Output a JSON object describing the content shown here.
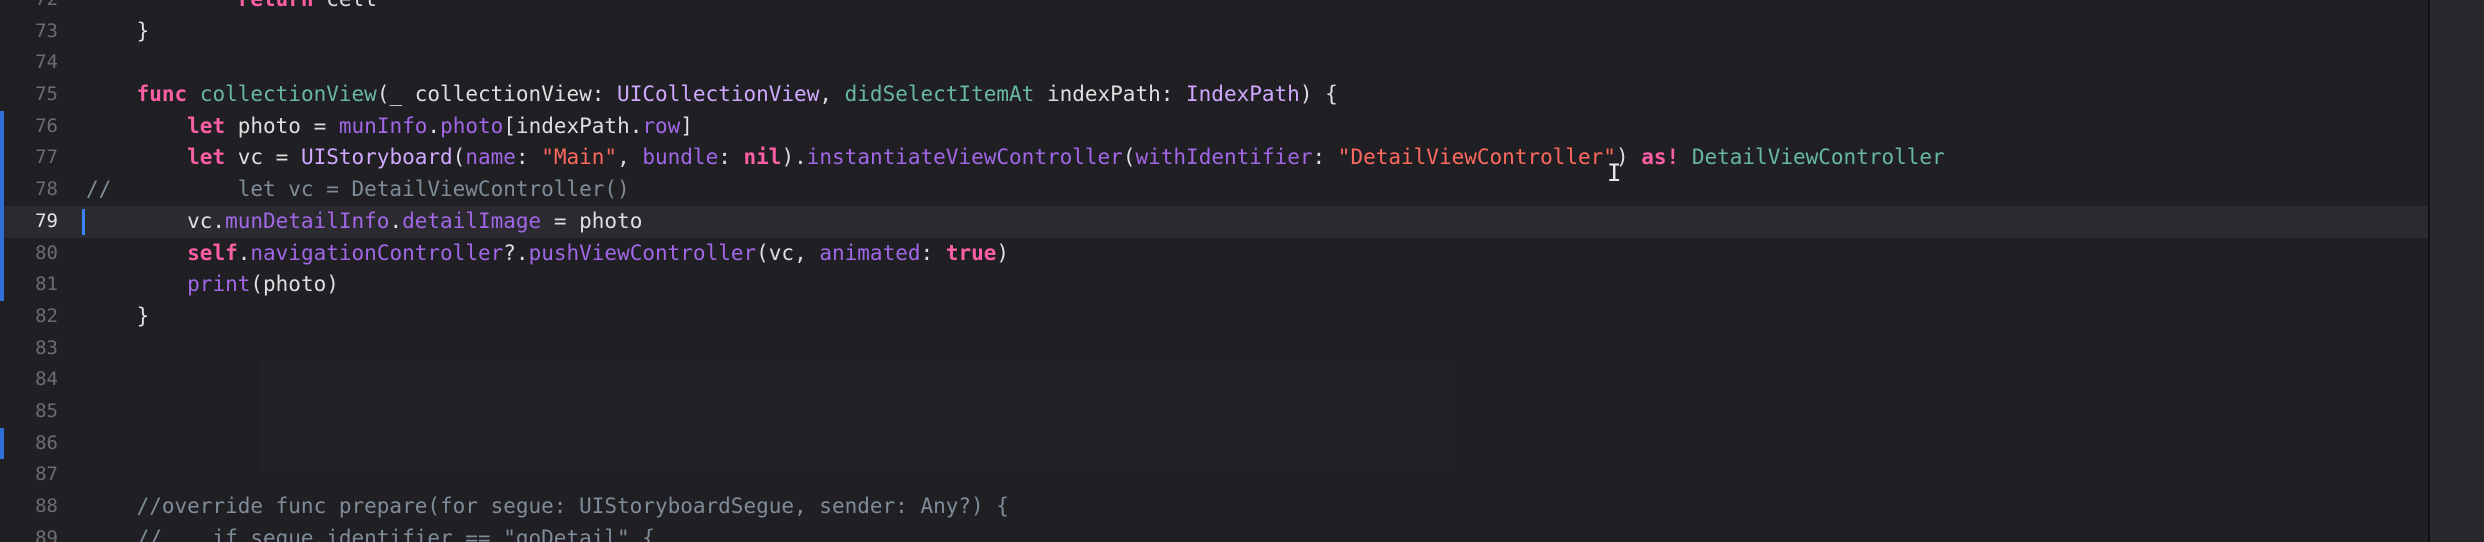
{
  "editor": {
    "lines": [
      {
        "num": "72",
        "changed": false,
        "current": false,
        "tokens": [
          {
            "t": "            ",
            "c": "plain"
          },
          {
            "t": "return",
            "c": "kw"
          },
          {
            "t": " cell",
            "c": "plain"
          }
        ]
      },
      {
        "num": "73",
        "changed": false,
        "current": false,
        "tokens": [
          {
            "t": "    }",
            "c": "plain"
          }
        ]
      },
      {
        "num": "74",
        "changed": false,
        "current": false,
        "tokens": []
      },
      {
        "num": "75",
        "changed": false,
        "current": false,
        "tokens": [
          {
            "t": "    ",
            "c": "plain"
          },
          {
            "t": "func",
            "c": "kw"
          },
          {
            "t": " ",
            "c": "plain"
          },
          {
            "t": "collectionView",
            "c": "fn"
          },
          {
            "t": "(_ collectionView: ",
            "c": "plain"
          },
          {
            "t": "UICollectionView",
            "c": "type"
          },
          {
            "t": ", ",
            "c": "plain"
          },
          {
            "t": "didSelectItemAt",
            "c": "fn"
          },
          {
            "t": " indexPath: ",
            "c": "plain"
          },
          {
            "t": "IndexPath",
            "c": "type"
          },
          {
            "t": ") {",
            "c": "plain"
          }
        ]
      },
      {
        "num": "76",
        "changed": true,
        "current": false,
        "tokens": [
          {
            "t": "        ",
            "c": "plain"
          },
          {
            "t": "let",
            "c": "kw"
          },
          {
            "t": " photo = ",
            "c": "plain"
          },
          {
            "t": "munInfo",
            "c": "prop"
          },
          {
            "t": ".",
            "c": "plain"
          },
          {
            "t": "photo",
            "c": "prop"
          },
          {
            "t": "[indexPath.",
            "c": "plain"
          },
          {
            "t": "row",
            "c": "prop"
          },
          {
            "t": "]",
            "c": "plain"
          }
        ]
      },
      {
        "num": "77",
        "changed": true,
        "current": false,
        "tokens": [
          {
            "t": "        ",
            "c": "plain"
          },
          {
            "t": "let",
            "c": "kw"
          },
          {
            "t": " vc = ",
            "c": "plain"
          },
          {
            "t": "UIStoryboard",
            "c": "type"
          },
          {
            "t": "(",
            "c": "plain"
          },
          {
            "t": "name",
            "c": "call"
          },
          {
            "t": ": ",
            "c": "plain"
          },
          {
            "t": "\"Main\"",
            "c": "str"
          },
          {
            "t": ", ",
            "c": "plain"
          },
          {
            "t": "bundle",
            "c": "call"
          },
          {
            "t": ": ",
            "c": "plain"
          },
          {
            "t": "nil",
            "c": "kw"
          },
          {
            "t": ").",
            "c": "plain"
          },
          {
            "t": "instantiateViewController",
            "c": "call"
          },
          {
            "t": "(",
            "c": "plain"
          },
          {
            "t": "withIdentifier",
            "c": "call"
          },
          {
            "t": ": ",
            "c": "plain"
          },
          {
            "t": "\"DetailViewController\"",
            "c": "str"
          },
          {
            "t": ") ",
            "c": "plain"
          },
          {
            "t": "as!",
            "c": "kw"
          },
          {
            "t": " ",
            "c": "plain"
          },
          {
            "t": "DetailViewController",
            "c": "fn"
          }
        ]
      },
      {
        "num": "78",
        "changed": true,
        "current": false,
        "tokens": [
          {
            "t": "//          let vc = DetailViewController()",
            "c": "comment"
          }
        ]
      },
      {
        "num": "79",
        "changed": true,
        "current": true,
        "tokens": [
          {
            "t": "        vc.",
            "c": "plain"
          },
          {
            "t": "munDetailInfo",
            "c": "prop"
          },
          {
            "t": ".",
            "c": "plain"
          },
          {
            "t": "detailImage",
            "c": "prop"
          },
          {
            "t": " = photo",
            "c": "plain"
          }
        ]
      },
      {
        "num": "80",
        "changed": true,
        "current": false,
        "tokens": [
          {
            "t": "        ",
            "c": "plain"
          },
          {
            "t": "self",
            "c": "kw"
          },
          {
            "t": ".",
            "c": "plain"
          },
          {
            "t": "navigationController",
            "c": "prop"
          },
          {
            "t": "?.",
            "c": "plain"
          },
          {
            "t": "pushViewController",
            "c": "call"
          },
          {
            "t": "(vc, ",
            "c": "plain"
          },
          {
            "t": "animated",
            "c": "call"
          },
          {
            "t": ": ",
            "c": "plain"
          },
          {
            "t": "true",
            "c": "kw"
          },
          {
            "t": ")",
            "c": "plain"
          }
        ]
      },
      {
        "num": "81",
        "changed": true,
        "current": false,
        "tokens": [
          {
            "t": "        ",
            "c": "plain"
          },
          {
            "t": "print",
            "c": "call"
          },
          {
            "t": "(photo)",
            "c": "plain"
          }
        ]
      },
      {
        "num": "82",
        "changed": false,
        "current": false,
        "tokens": [
          {
            "t": "    }",
            "c": "plain"
          }
        ]
      },
      {
        "num": "83",
        "changed": false,
        "current": false,
        "tokens": []
      },
      {
        "num": "84",
        "changed": false,
        "current": false,
        "tokens": []
      },
      {
        "num": "85",
        "changed": false,
        "current": false,
        "tokens": []
      },
      {
        "num": "86",
        "changed": true,
        "current": false,
        "tokens": []
      },
      {
        "num": "87",
        "changed": false,
        "current": false,
        "tokens": []
      },
      {
        "num": "88",
        "changed": false,
        "current": false,
        "tokens": [
          {
            "t": "    //override func prepare(for segue: UIStoryboardSegue, sender: Any?) {",
            "c": "comment"
          }
        ]
      },
      {
        "num": "89",
        "changed": false,
        "current": false,
        "tokens": [
          {
            "t": "    //    if segue.identifier == \"goDetail\" {",
            "c": "comment"
          }
        ]
      }
    ]
  },
  "colors": {
    "background": "#1f1f24",
    "keyword": "#fc5fa3",
    "string": "#fc6a5d",
    "comment": "#7f8c98",
    "type": "#d0a8ff",
    "function": "#67b7a4",
    "change_bar": "#2e6fd8"
  },
  "icons": {
    "text_cursor": "i-beam-cursor-icon"
  }
}
